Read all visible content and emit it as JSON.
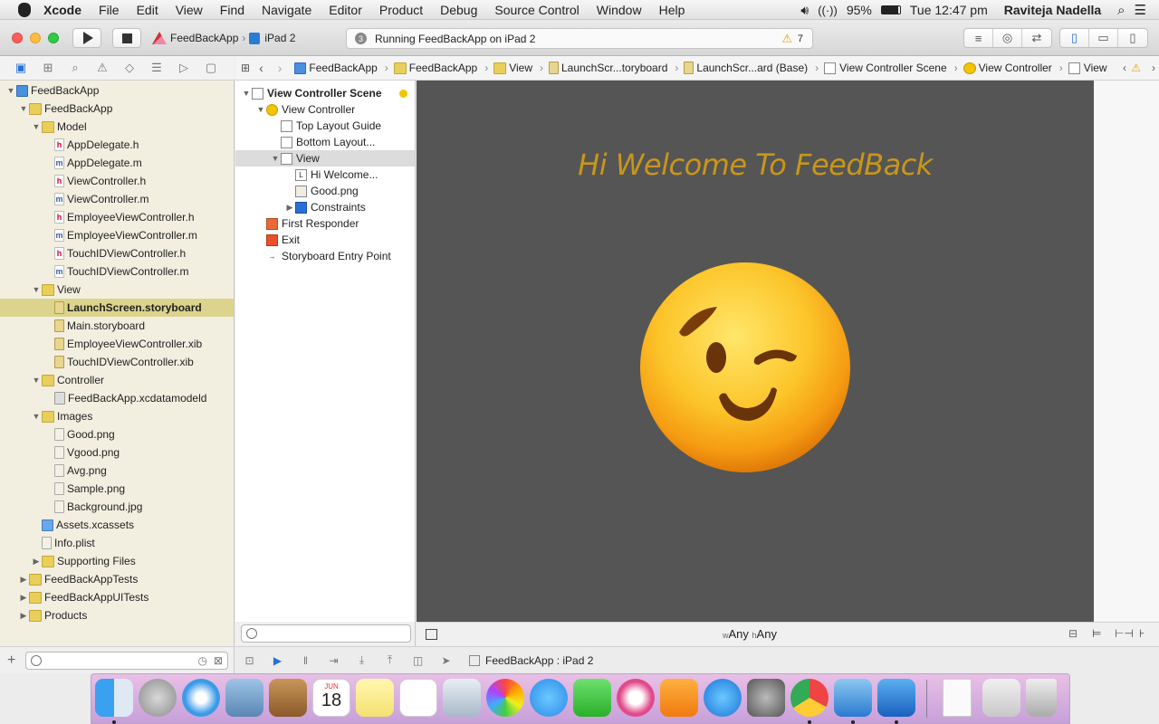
{
  "menubar": {
    "app": "Xcode",
    "items": [
      "File",
      "Edit",
      "View",
      "Find",
      "Navigate",
      "Editor",
      "Product",
      "Debug",
      "Source Control",
      "Window",
      "Help"
    ],
    "battery": "95%",
    "time": "Tue 12:47 pm",
    "user": "Raviteja Nadella"
  },
  "toolbar": {
    "scheme": "FeedBackApp",
    "device": "iPad 2",
    "activity_badge": "3",
    "activity": "Running FeedBackApp on iPad 2",
    "warnings": "7"
  },
  "navigator": {
    "rows": [
      {
        "label": "FeedBackApp",
        "depth": 0,
        "type": "proj",
        "tri": "open"
      },
      {
        "label": "FeedBackApp",
        "depth": 1,
        "type": "folder",
        "tri": "open"
      },
      {
        "label": "Model",
        "depth": 2,
        "type": "folder",
        "tri": "open"
      },
      {
        "label": "AppDelegate.h",
        "depth": 3,
        "type": "h",
        "tri": ""
      },
      {
        "label": "AppDelegate.m",
        "depth": 3,
        "type": "m",
        "tri": ""
      },
      {
        "label": "ViewController.h",
        "depth": 3,
        "type": "h",
        "tri": ""
      },
      {
        "label": "ViewController.m",
        "depth": 3,
        "type": "m",
        "tri": ""
      },
      {
        "label": "EmployeeViewController.h",
        "depth": 3,
        "type": "h",
        "tri": ""
      },
      {
        "label": "EmployeeViewController.m",
        "depth": 3,
        "type": "m",
        "tri": ""
      },
      {
        "label": "TouchIDViewController.h",
        "depth": 3,
        "type": "h",
        "tri": ""
      },
      {
        "label": "TouchIDViewController.m",
        "depth": 3,
        "type": "m",
        "tri": ""
      },
      {
        "label": "View",
        "depth": 2,
        "type": "folder",
        "tri": "open"
      },
      {
        "label": "LaunchScreen.storyboard",
        "depth": 3,
        "type": "sb",
        "tri": "",
        "selected": true
      },
      {
        "label": "Main.storyboard",
        "depth": 3,
        "type": "sb",
        "tri": ""
      },
      {
        "label": "EmployeeViewController.xib",
        "depth": 3,
        "type": "sb",
        "tri": ""
      },
      {
        "label": "TouchIDViewController.xib",
        "depth": 3,
        "type": "sb",
        "tri": ""
      },
      {
        "label": "Controller",
        "depth": 2,
        "type": "folder",
        "tri": "open"
      },
      {
        "label": "FeedBackApp.xcdatamodeld",
        "depth": 3,
        "type": "xcd",
        "tri": ""
      },
      {
        "label": "Images",
        "depth": 2,
        "type": "folder",
        "tri": "open"
      },
      {
        "label": "Good.png",
        "depth": 3,
        "type": "png",
        "tri": ""
      },
      {
        "label": "Vgood.png",
        "depth": 3,
        "type": "png",
        "tri": ""
      },
      {
        "label": "Avg.png",
        "depth": 3,
        "type": "png",
        "tri": ""
      },
      {
        "label": "Sample.png",
        "depth": 3,
        "type": "png",
        "tri": ""
      },
      {
        "label": "Background.jpg",
        "depth": 3,
        "type": "png",
        "tri": ""
      },
      {
        "label": "Assets.xcassets",
        "depth": 2,
        "type": "assets",
        "tri": ""
      },
      {
        "label": "Info.plist",
        "depth": 2,
        "type": "png",
        "tri": ""
      },
      {
        "label": "Supporting Files",
        "depth": 2,
        "type": "folder",
        "tri": "closed"
      },
      {
        "label": "FeedBackAppTests",
        "depth": 1,
        "type": "folder",
        "tri": "closed"
      },
      {
        "label": "FeedBackAppUITests",
        "depth": 1,
        "type": "folder",
        "tri": "closed"
      },
      {
        "label": "Products",
        "depth": 1,
        "type": "folder",
        "tri": "closed"
      }
    ]
  },
  "jumpbar": [
    "FeedBackApp",
    "FeedBackApp",
    "View",
    "LaunchScr...toryboard",
    "LaunchScr...ard (Base)",
    "View Controller Scene",
    "View Controller",
    "View"
  ],
  "outline": {
    "rows": [
      {
        "label": "View Controller Scene",
        "depth": 0,
        "tri": "open",
        "bold": true
      },
      {
        "label": "View Controller",
        "depth": 1,
        "tri": "open"
      },
      {
        "label": "Top Layout Guide",
        "depth": 2,
        "tri": ""
      },
      {
        "label": "Bottom Layout...",
        "depth": 2,
        "tri": ""
      },
      {
        "label": "View",
        "depth": 2,
        "tri": "open",
        "selected": true
      },
      {
        "label": "Hi Welcome...",
        "depth": 3,
        "tri": "",
        "icon": "L"
      },
      {
        "label": "Good.png",
        "depth": 3,
        "tri": ""
      },
      {
        "label": "Constraints",
        "depth": 3,
        "tri": "closed"
      },
      {
        "label": "First Responder",
        "depth": 1,
        "tri": ""
      },
      {
        "label": "Exit",
        "depth": 1,
        "tri": ""
      },
      {
        "label": "Storyboard Entry Point",
        "depth": 1,
        "tri": ""
      }
    ]
  },
  "canvas": {
    "welcome_text": "Hi Welcome To FeedBack",
    "size_class_w": "Any",
    "size_class_h": "Any",
    "w_prefix": "w",
    "h_prefix": "h"
  },
  "debugbar": {
    "target": "FeedBackApp : iPad 2"
  },
  "dock": {
    "calendar_month": "JUN",
    "calendar_day": "18"
  }
}
